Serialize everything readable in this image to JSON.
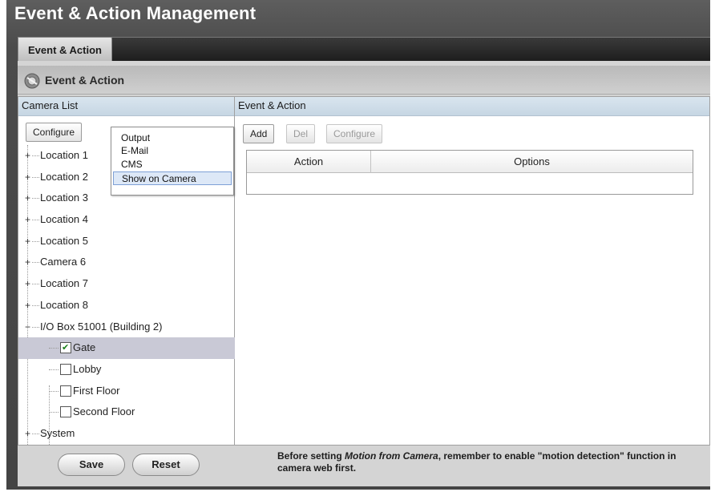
{
  "app": {
    "title": "Event & Action Management"
  },
  "tabs": [
    {
      "label": "Event & Action",
      "active": true
    }
  ],
  "section": {
    "title": "Event & Action",
    "icon": "gear-icon"
  },
  "left_panel": {
    "header": "Camera List",
    "configure_label": "Configure",
    "menu_items": [
      {
        "label": "Output",
        "highlighted": false
      },
      {
        "label": "E-Mail",
        "highlighted": false
      },
      {
        "label": "CMS",
        "highlighted": false
      },
      {
        "label": "Show on Camera",
        "highlighted": true
      }
    ],
    "tree": [
      {
        "label": "Location 1",
        "expander": "+"
      },
      {
        "label": "Location 2",
        "expander": "+"
      },
      {
        "label": "Location 3",
        "expander": "+"
      },
      {
        "label": "Location 4",
        "expander": "+"
      },
      {
        "label": "Location 5",
        "expander": "+"
      },
      {
        "label": "Camera 6",
        "expander": "+"
      },
      {
        "label": "Location 7",
        "expander": "+"
      },
      {
        "label": "Location 8",
        "expander": "+"
      },
      {
        "label": "I/O Box 51001 (Building 2)",
        "expander": "−"
      },
      {
        "label": "Gate",
        "child": true,
        "checked": true,
        "selected": true
      },
      {
        "label": "Lobby",
        "child": true,
        "checked": false
      },
      {
        "label": "First Floor",
        "child": true,
        "checked": false
      },
      {
        "label": "Second Floor",
        "child": true,
        "checked": false
      },
      {
        "label": "System",
        "expander": "+"
      }
    ]
  },
  "right_panel": {
    "header": "Event & Action",
    "toolbar": {
      "add_label": "Add",
      "del_label": "Del",
      "configure_label": "Configure"
    },
    "table": {
      "columns": [
        "Action",
        "Options"
      ],
      "rows": []
    }
  },
  "footer": {
    "save_label": "Save",
    "reset_label": "Reset",
    "note_prefix": "Before setting ",
    "note_em": "Motion from Camera",
    "note_suffix": ", remember to enable \"motion detection\" function in camera web first."
  },
  "colors": {
    "frame": "#4b4b4b",
    "panel_header": "#d9e5ef",
    "menu_highlight": "#dde8f7",
    "selected_row": "#c9c9d6"
  }
}
